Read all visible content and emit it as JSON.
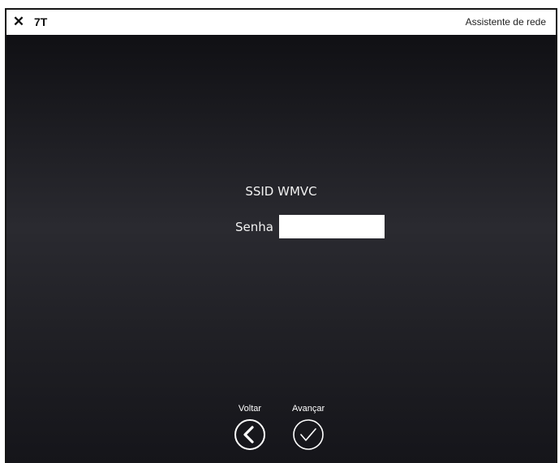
{
  "titlebar": {
    "close_glyph": "✕",
    "app_code": "7T",
    "title": "Assistente de rede"
  },
  "network": {
    "ssid_line": "SSID WMVC",
    "password_label": "Senha",
    "password_value": "",
    "password_placeholder": ""
  },
  "navigation": {
    "back_label": "Voltar",
    "back_icon": "chevron-left-icon",
    "next_label": "Avançar",
    "next_icon": "checkmark-icon"
  },
  "colors": {
    "titlebar_bg": "#ffffff",
    "content_bg_dark": "#141418",
    "content_bg_mid": "#2a2a30",
    "text_light": "#f2f2f2"
  }
}
